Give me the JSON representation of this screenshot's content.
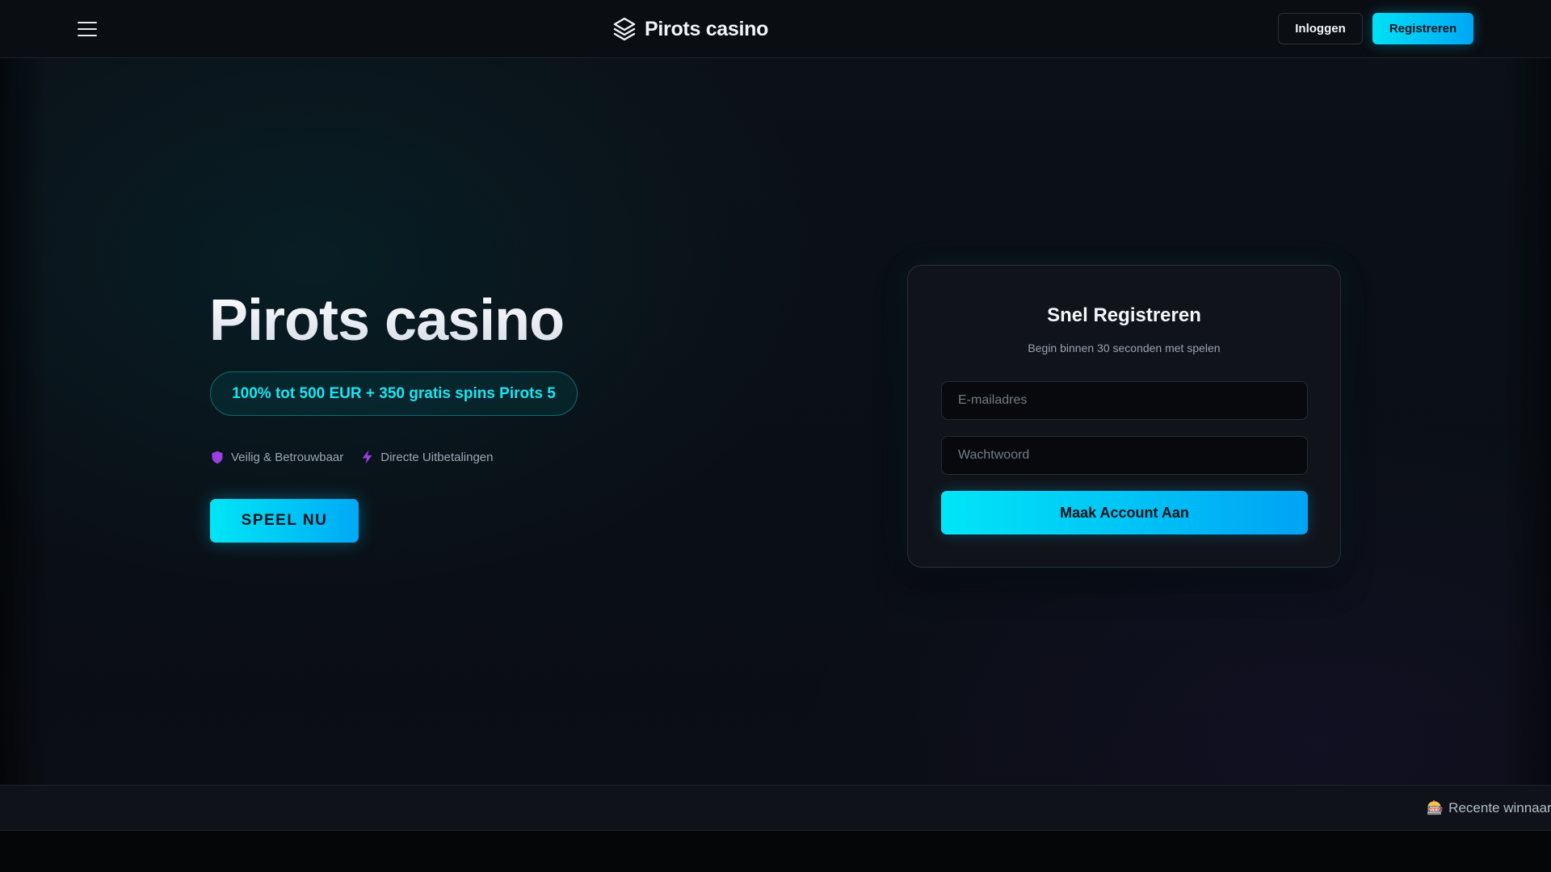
{
  "header": {
    "brand": "Pirots casino",
    "login_label": "Inloggen",
    "register_label": "Registreren"
  },
  "hero": {
    "title": "Pirots casino",
    "bonus": "100% tot 500 EUR + 350 gratis spins Pirots 5",
    "features": [
      {
        "icon": "shield-icon",
        "label": "Veilig & Betrouwbaar"
      },
      {
        "icon": "lightning-icon",
        "label": "Directe Uitbetalingen"
      }
    ],
    "play_label": "SPEEL NU"
  },
  "registration": {
    "title": "Snel Registreren",
    "subtitle": "Begin binnen 30 seconden met spelen",
    "email_placeholder": "E-mailadres",
    "password_placeholder": "Wachtwoord",
    "submit_label": "Maak Account Aan"
  },
  "ticker": {
    "icon": "slot-machine-icon",
    "text": "Recente winnaar:"
  },
  "colors": {
    "accent": "#00e1f5",
    "accent_end": "#00a6f5",
    "bonus_text": "#17e6f2",
    "feature_icon": "#9b3fe0",
    "background": "#0a0d12"
  }
}
